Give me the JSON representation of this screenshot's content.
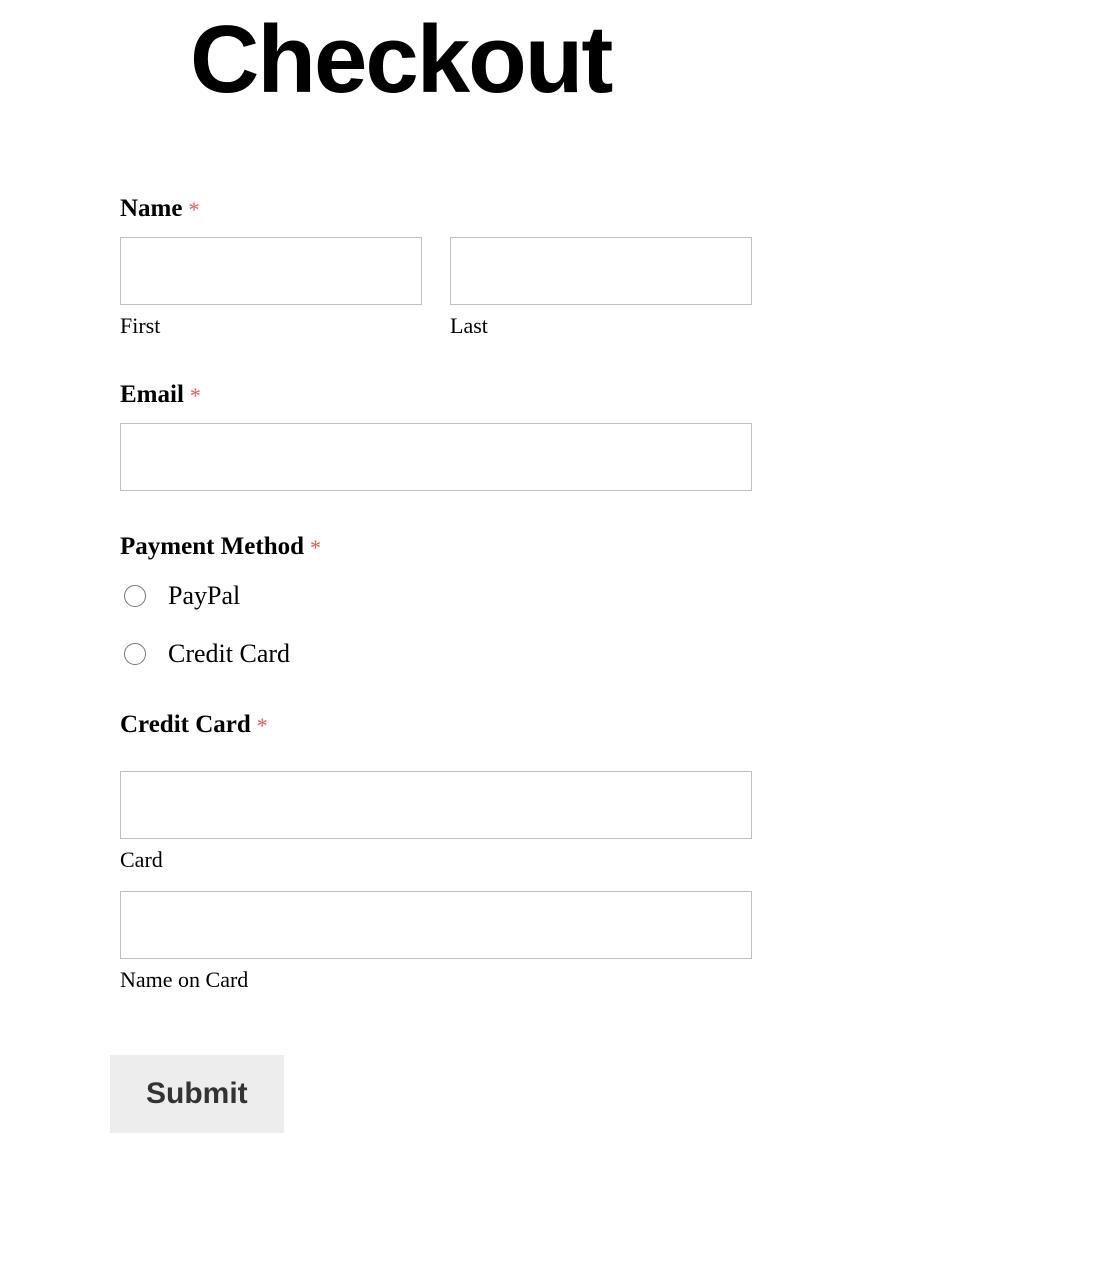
{
  "page": {
    "title": "Checkout"
  },
  "form": {
    "name": {
      "label": "Name",
      "required_marker": "*",
      "first_sublabel": "First",
      "last_sublabel": "Last",
      "first_value": "",
      "last_value": ""
    },
    "email": {
      "label": "Email",
      "required_marker": "*",
      "value": ""
    },
    "payment_method": {
      "label": "Payment Method",
      "required_marker": "*",
      "options": {
        "paypal": "PayPal",
        "credit_card": "Credit Card"
      }
    },
    "credit_card": {
      "label": "Credit Card",
      "required_marker": "*",
      "card_sublabel": "Card",
      "name_on_card_sublabel": "Name on Card",
      "card_value": "",
      "name_on_card_value": ""
    },
    "submit_label": "Submit"
  }
}
